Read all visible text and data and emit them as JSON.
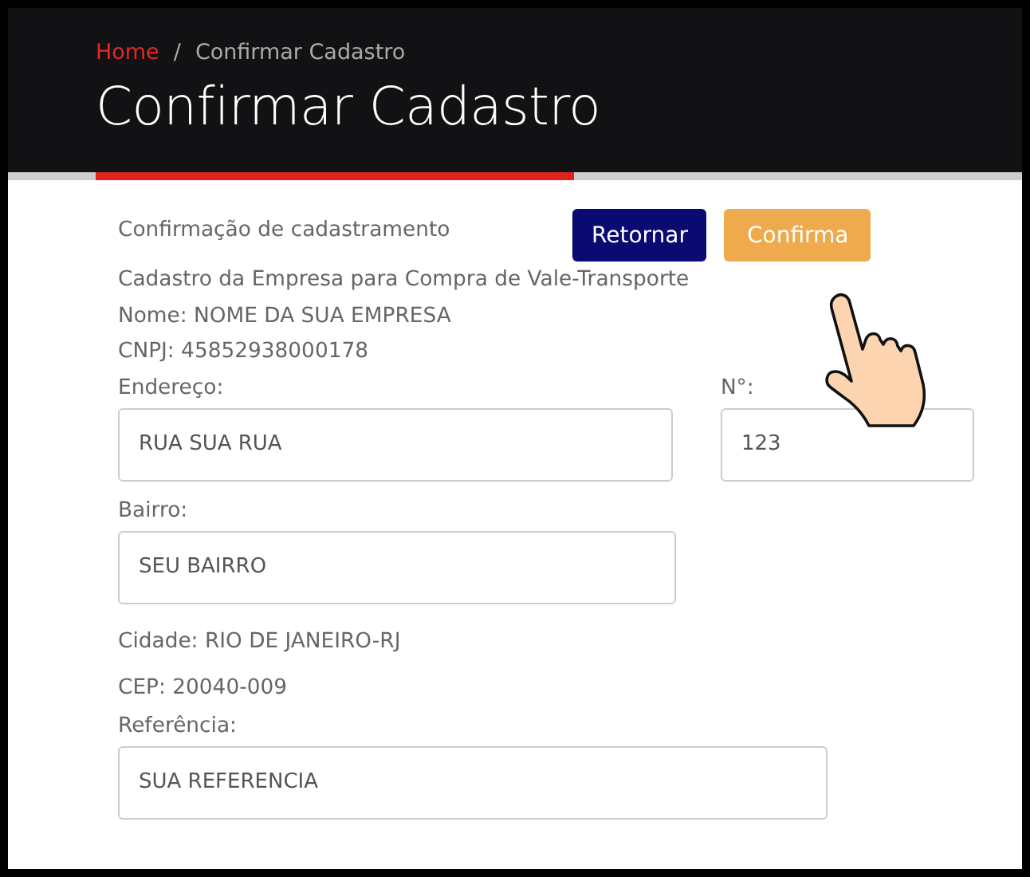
{
  "breadcrumb": [
    {
      "label": "Home",
      "kind": "link"
    },
    {
      "label": "Confirmar Cadastro",
      "kind": "current"
    }
  ],
  "breadcrumb_separator": "/",
  "page_title": "Confirmar Cadastro",
  "form": {
    "heading": "Confirmação de cadastramento",
    "buttons": [
      {
        "label": "Retornar",
        "kind": "secondary"
      },
      {
        "label": "Confirma",
        "kind": "primary"
      }
    ],
    "info_lines": [
      "Cadastro da Empresa para Compra de Vale-Transporte",
      "Nome: NOME DA SUA EMPRESA",
      "CNPJ: 45852938000178"
    ],
    "address": {
      "label": "Endereço:",
      "value": "RUA SUA RUA"
    },
    "number": {
      "label": "N°:",
      "value": "123"
    },
    "district": {
      "label": "Bairro:",
      "value": "SEU BAIRRO"
    },
    "city_line": "Cidade: RIO DE JANEIRO-RJ",
    "cep_line": "CEP: 20040-009",
    "reference": {
      "label": "Referência:",
      "value": "SUA REFERENCIA"
    }
  }
}
